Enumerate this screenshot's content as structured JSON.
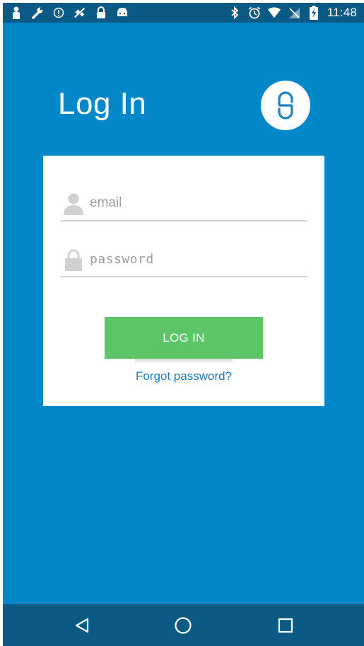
{
  "status_bar": {
    "time": "11:48",
    "left_icons": [
      "person-icon",
      "wrench-icon",
      "info-icon",
      "satellite-icon",
      "lock-icon",
      "android-icon"
    ],
    "right_icons": [
      "bluetooth-icon",
      "alarm-icon",
      "wifi-icon",
      "no-signal-icon",
      "battery-charging-icon"
    ]
  },
  "header": {
    "title": "Log In",
    "logo_icon": "app-logo-icon"
  },
  "form": {
    "email": {
      "placeholder": "email",
      "value": "",
      "icon": "person-icon"
    },
    "password": {
      "placeholder": "password",
      "value": "",
      "icon": "lock-icon"
    },
    "login_label": "LOG IN",
    "forgot_label": "Forgot password?"
  },
  "nav_bar": {
    "buttons": [
      "back-icon",
      "home-icon",
      "recents-icon"
    ]
  },
  "colors": {
    "background": "#0288c9",
    "status_bar": "#0b5a86",
    "button": "#5cc666",
    "link": "#1f79b5"
  }
}
